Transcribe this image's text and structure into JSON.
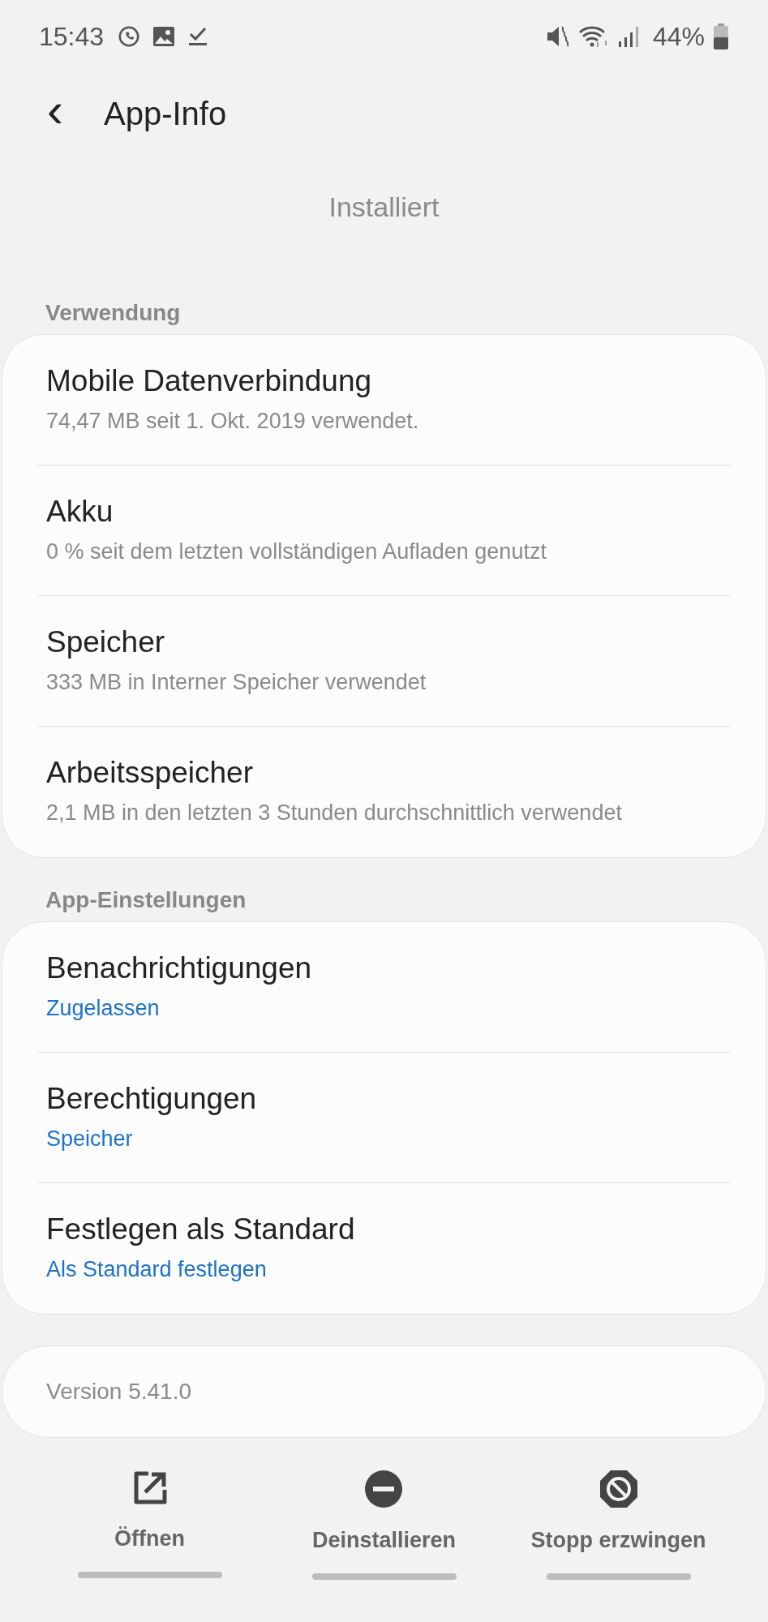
{
  "status_bar": {
    "time": "15:43",
    "battery": "44%"
  },
  "header": {
    "back": "‹",
    "title": "App-Info"
  },
  "install_state": "Installiert",
  "sections": [
    {
      "title": "Verwendung",
      "items": [
        {
          "title": "Mobile Datenverbindung",
          "subtitle": "74,47 MB seit 1. Okt. 2019 verwendet.",
          "kind": "info"
        },
        {
          "title": "Akku",
          "subtitle": "0 % seit dem letzten vollständigen Aufladen genutzt",
          "kind": "info"
        },
        {
          "title": "Speicher",
          "subtitle": "333 MB in Interner Speicher verwendet",
          "kind": "info"
        },
        {
          "title": "Arbeitsspeicher",
          "subtitle": "2,1 MB in den letzten 3 Stunden durchschnittlich verwendet",
          "kind": "info"
        }
      ]
    },
    {
      "title": "App-Einstellungen",
      "items": [
        {
          "title": "Benachrichtigungen",
          "subtitle": "Zugelassen",
          "kind": "link"
        },
        {
          "title": "Berechtigungen",
          "subtitle": "Speicher",
          "kind": "link"
        },
        {
          "title": "Festlegen als Standard",
          "subtitle": "Als Standard festlegen",
          "kind": "link"
        }
      ]
    }
  ],
  "version": "Version 5.41.0",
  "actions": [
    {
      "label": "Öffnen",
      "kind": "open"
    },
    {
      "label": "Deinstallieren",
      "kind": "uninstall"
    },
    {
      "label": "Stopp erzwingen",
      "kind": "stop"
    }
  ]
}
